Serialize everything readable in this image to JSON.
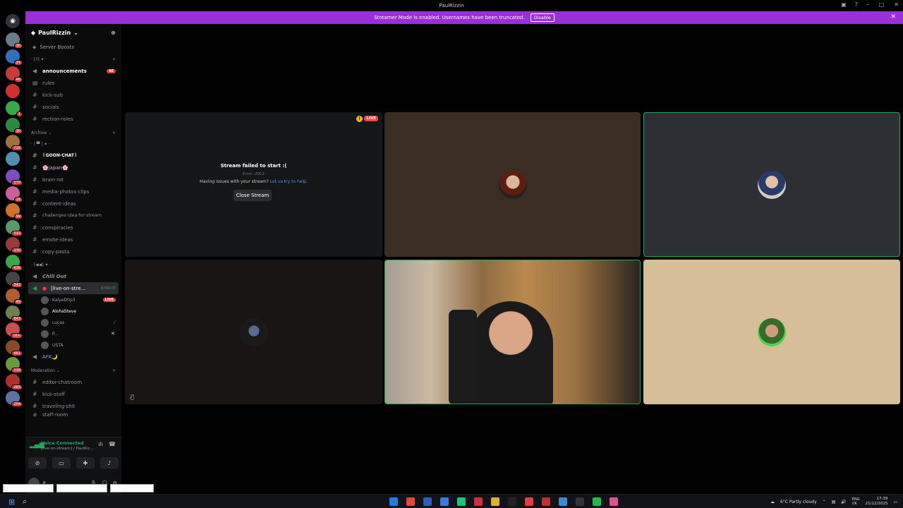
{
  "window": {
    "title": "PaulRizzin"
  },
  "banner": {
    "text": "Streamer Mode is enabled. Usernames have been truncated.",
    "button": "Disable"
  },
  "guild_badges": [
    "30",
    "24",
    "46",
    "",
    "1",
    "30",
    "726",
    "",
    "170",
    "16",
    "99",
    "333",
    "130",
    "436",
    "342",
    "49",
    "843",
    "1K+",
    "461",
    "238",
    "283",
    "254"
  ],
  "server": {
    "name": "PaulRizzin",
    "boosts": "Server Boosts"
  },
  "categories": {
    "first": "· [?] ✦ ·",
    "archive": "Archive",
    "second": "· | ▀ | ✦ ·",
    "voice": "· [◀◀] ✦ ·",
    "moderation": "Moderation"
  },
  "channels": {
    "announcements": "announcements",
    "announcements_unread": "48",
    "rules": "rules",
    "kick_sub": "kick-sub",
    "socials": "socials",
    "rection_roles": "rection-roles",
    "goon_chat": "꒰GOON-CHAT꒱",
    "japan": "🌸japan🌸",
    "brain_rot": "brain·rot",
    "media": "media-photos-clips",
    "content_ideas": "content·ideas",
    "challenges": "challenges·idea·for·stream",
    "conspiracies": "conspiracies",
    "emote_ideas": "emote·ideas",
    "copypasta": "copy·pasta",
    "chill_out": "Chill Out",
    "live_on_stream": "[live-on-stre...",
    "live_timer": "3:59:07",
    "afk": "AFK🌙",
    "editor_chatroom": "editor-chatroom",
    "kick_staff": "kick-staff",
    "traveling": "traveling-shit",
    "staff_room": "staff-room"
  },
  "voice_users": [
    {
      "name": "KalyeD0p3",
      "live": "LIVE"
    },
    {
      "name": "AlohaSteve"
    },
    {
      "name": "Lucas"
    },
    {
      "name": "P..."
    },
    {
      "name": "USTA"
    }
  ],
  "voice_panel": {
    "status": "Voice Connected",
    "channel": "[live-on-stream] / PaulRiz..."
  },
  "user_panel": {
    "name": "P..."
  },
  "stream_error": {
    "title": "Stream failed to start :(",
    "code": "Error: 2012",
    "help": "Having issues with your stream?",
    "help_link": "Let us try to help.",
    "close_button": "Close Stream",
    "live": "LIVE"
  },
  "tray": {
    "weather": "6°C Partly cloudy",
    "lang1": "ENG",
    "lang2": "UK",
    "time": "17:39",
    "date": "21/12/2025"
  },
  "colors": {
    "banner": "#9b30d9",
    "speaking": "#23a55a",
    "live": "#ed4245"
  }
}
